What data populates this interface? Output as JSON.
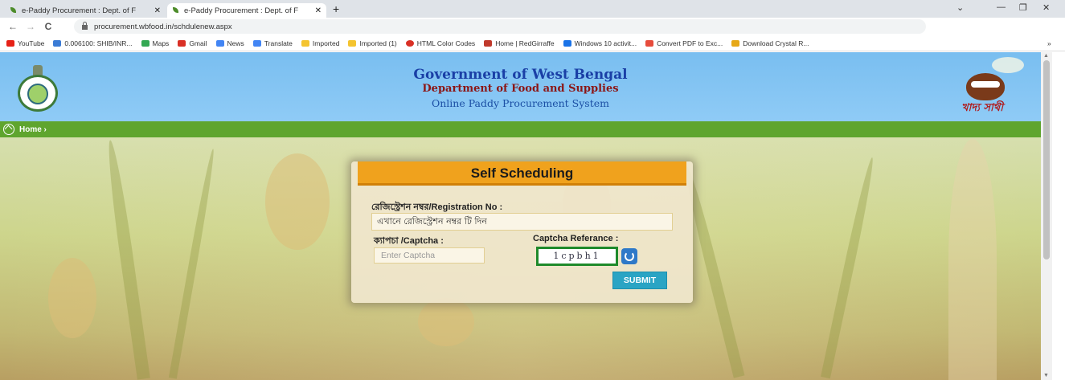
{
  "browser": {
    "tabs": [
      {
        "title": "e-Paddy Procurement : Dept. of F",
        "close": "✕"
      },
      {
        "title": "e-Paddy Procurement : Dept. of F",
        "close": "✕"
      }
    ],
    "new_tab": "+",
    "url": "procurement.wbfood.in/schdulenew.aspx",
    "bookmarks": [
      {
        "label": "YouTube",
        "color": "#e62117"
      },
      {
        "label": "0.006100: SHIB/INR...",
        "color": "#3a7bd5"
      },
      {
        "label": "Maps",
        "color": "#34a853"
      },
      {
        "label": "Gmail",
        "color": "#d93025"
      },
      {
        "label": "News",
        "color": "#4285f4"
      },
      {
        "label": "Translate",
        "color": "#4285f4"
      },
      {
        "label": "Imported",
        "color": "#f4c430"
      },
      {
        "label": "Imported (1)",
        "color": "#f4c430"
      },
      {
        "label": "HTML Color Codes",
        "color": "#d93025"
      },
      {
        "label": "Home | RedGirraffe",
        "color": "#c0392b"
      },
      {
        "label": "Windows 10 activit...",
        "color": "#1a73e8"
      },
      {
        "label": "Convert PDF to Exc...",
        "color": "#e74c3c"
      },
      {
        "label": "Download Crystal R...",
        "color": "#e6a817"
      }
    ],
    "more_bookmarks": "»"
  },
  "header": {
    "title": "Government of West Bengal",
    "department": "Department of Food and Supplies",
    "system": "Online Paddy Procurement System",
    "logo_text": "খাদ্য সাথী"
  },
  "nav": {
    "home_label": "Home ›"
  },
  "form": {
    "heading": "Self Scheduling",
    "registration_label": "রেজিস্ট্রেশন নম্বর/Registration No :",
    "registration_placeholder": "এখানে রেজিস্ট্রেশন নম্বর টি দিন",
    "captcha_label": "ক্যাপচা /Captcha :",
    "captcha_placeholder": "Enter Captcha",
    "captcha_ref_label": "Captcha Referance :",
    "captcha_code": "1cpbh1",
    "submit_label": "SUBMIT"
  },
  "colors": {
    "header_bg": "#79bef0",
    "nav_bg": "#5fa52e",
    "card_head": "#f0a21d",
    "submit": "#2aa4c4"
  }
}
